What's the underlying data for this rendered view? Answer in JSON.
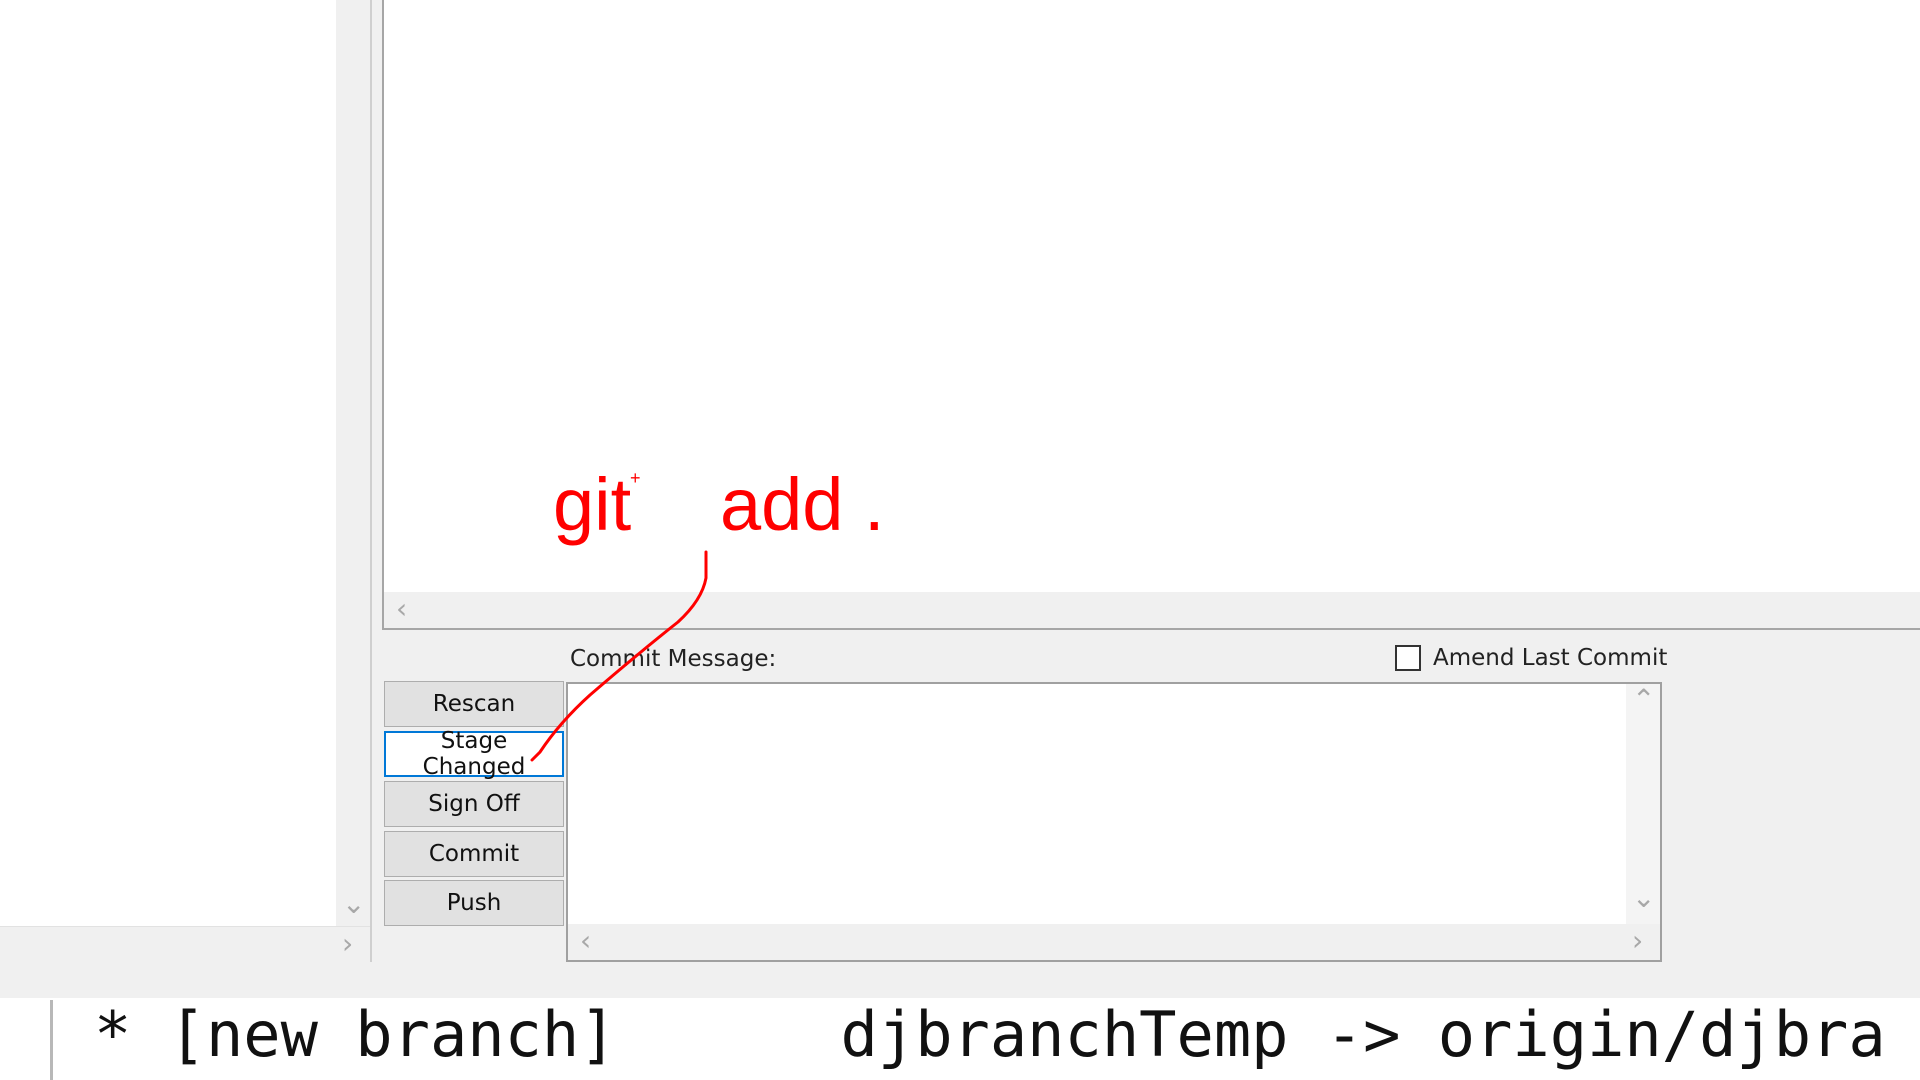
{
  "diff_view": {
    "hscroll_left_icon": "chevron-left-icon"
  },
  "left_pane": {
    "vscroll_down_icon": "chevron-down-icon",
    "hscroll_right_icon": "chevron-right-icon"
  },
  "buttons": {
    "rescan": "Rescan",
    "stage_changed": "Stage Changed",
    "sign_off": "Sign Off",
    "commit": "Commit",
    "push": "Push"
  },
  "commit_panel": {
    "message_label": "Commit Message:",
    "amend_label": "Amend Last Commit",
    "amend_checked": false,
    "message_value": ""
  },
  "terminal": {
    "line": "* [new branch]      djbranchTemp -> origin/djbra"
  },
  "annotation": {
    "text_git": "git",
    "text_add": "add .",
    "cursor_mark": "+",
    "color": "#ff0000"
  },
  "colors": {
    "focus_border": "#0078d7",
    "panel_bg": "#f0f0f0"
  }
}
